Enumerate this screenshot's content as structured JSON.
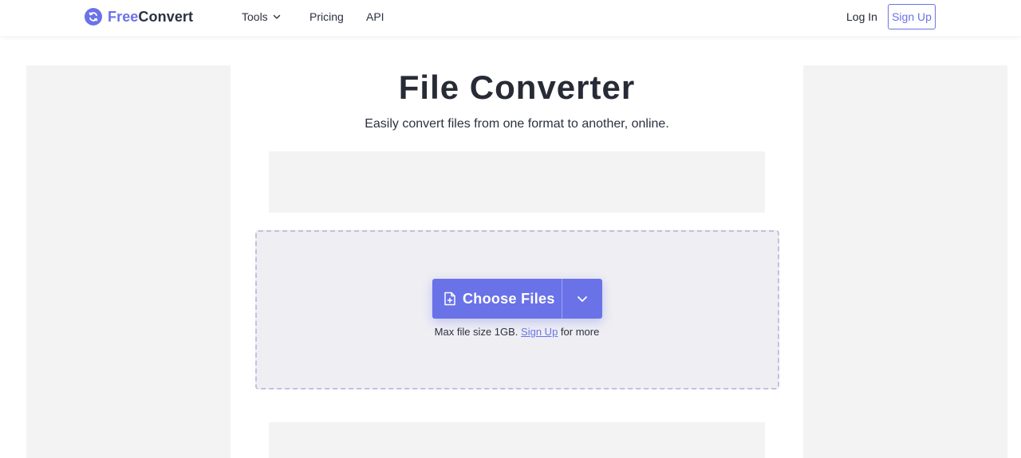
{
  "header": {
    "logo_free": "Free",
    "logo_convert": "Convert",
    "nav": {
      "tools": "Tools",
      "pricing": "Pricing",
      "api": "API"
    },
    "login": "Log In",
    "signup": "Sign Up"
  },
  "main": {
    "title": "File Converter",
    "subtitle": "Easily convert files from one format to another, online.",
    "choose_files": "Choose Files",
    "hint_before": "Max file size 1GB.",
    "hint_link": "Sign Up",
    "hint_after": "for more"
  },
  "colors": {
    "accent": "#6a72e8",
    "dropzone_bg": "#eeeef3",
    "ad_placeholder": "#f3f3f3"
  },
  "icons": {
    "logo": "refresh-circle-icon",
    "tools_chevron": "chevron-down-icon",
    "choose_file": "file-plus-icon",
    "choose_dropdown": "chevron-down-icon"
  }
}
